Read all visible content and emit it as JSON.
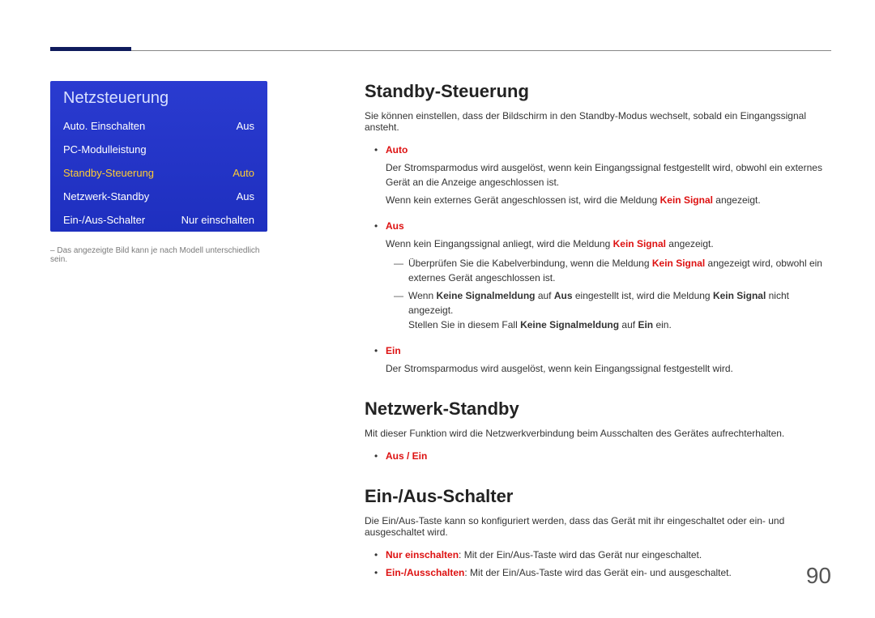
{
  "menu": {
    "title": "Netzsteuerung",
    "items": [
      {
        "label": "Auto. Einschalten",
        "value": "Aus"
      },
      {
        "label": "PC-Modulleistung",
        "value": ""
      },
      {
        "label": "Standby-Steuerung",
        "value": "Auto"
      },
      {
        "label": "Netzwerk-Standby",
        "value": "Aus"
      },
      {
        "label": "Ein-/Aus-Schalter",
        "value": "Nur einschalten"
      }
    ],
    "note": "Das angezeigte Bild kann je nach Modell unterschiedlich sein."
  },
  "sections": {
    "standby": {
      "heading": "Standby-Steuerung",
      "lead": "Sie können einstellen, dass der Bildschirm in den Standby-Modus wechselt, sobald ein Eingangssignal ansteht.",
      "auto_label": "Auto",
      "auto_p1": "Der Stromsparmodus wird ausgelöst, wenn kein Eingangssignal festgestellt wird, obwohl ein externes Gerät an die Anzeige angeschlossen ist.",
      "auto_p2a": "Wenn kein externes Gerät angeschlossen ist, wird die Meldung ",
      "auto_p2b": "Kein Signal",
      "auto_p2c": " angezeigt.",
      "aus_label": "Aus",
      "aus_p1a": "Wenn kein Eingangssignal anliegt, wird die Meldung ",
      "aus_p1b": "Kein Signal",
      "aus_p1c": " angezeigt.",
      "aus_sub1a": "Überprüfen Sie die Kabelverbindung, wenn die Meldung ",
      "aus_sub1b": "Kein Signal",
      "aus_sub1c": " angezeigt wird, obwohl ein externes Gerät angeschlossen ist.",
      "aus_sub2a": "Wenn ",
      "aus_sub2b": "Keine Signalmeldung",
      "aus_sub2c": " auf ",
      "aus_sub2d": "Aus",
      "aus_sub2e": " eingestellt ist, wird die Meldung ",
      "aus_sub2f": "Kein Signal",
      "aus_sub2g": " nicht angezeigt.",
      "aus_sub2h": "Stellen Sie in diesem Fall ",
      "aus_sub2i": "Keine Signalmeldung",
      "aus_sub2j": " auf ",
      "aus_sub2k": "Ein",
      "aus_sub2l": " ein.",
      "ein_label": "Ein",
      "ein_p1": "Der Stromsparmodus wird ausgelöst, wenn kein Eingangssignal festgestellt wird."
    },
    "netzwerk": {
      "heading": "Netzwerk-Standby",
      "lead": "Mit dieser Funktion wird die Netzwerkverbindung beim Ausschalten des Gerätes aufrechterhalten.",
      "opt": "Aus / Ein"
    },
    "schalter": {
      "heading": "Ein-/Aus-Schalter",
      "lead": "Die Ein/Aus-Taste kann so konfiguriert werden, dass das Gerät mit ihr eingeschaltet oder ein- und ausgeschaltet wird.",
      "opt1_label": "Nur einschalten",
      "opt1_text": ": Mit der Ein/Aus-Taste wird das Gerät nur eingeschaltet.",
      "opt2_label": "Ein-/Ausschalten",
      "opt2_text": ": Mit der Ein/Aus-Taste wird das Gerät ein- und ausgeschaltet."
    }
  },
  "page_number": "90"
}
